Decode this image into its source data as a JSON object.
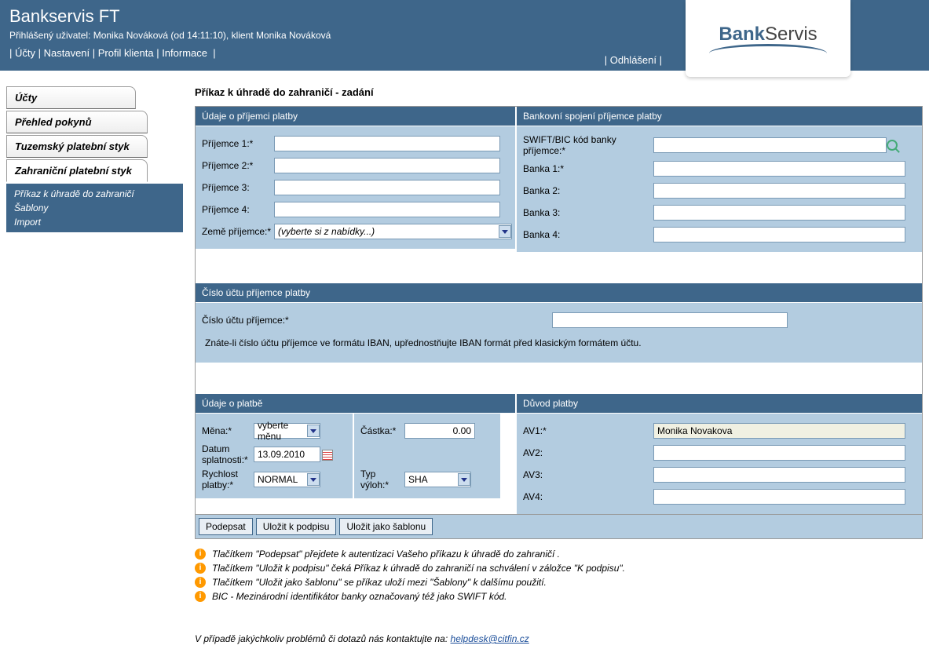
{
  "header": {
    "title": "Bankservis FT",
    "sub": "Přihlášený uživatel: Monika Nováková (od 14:11:10), klient Monika Nováková",
    "nav": [
      "Účty",
      "Nastavení",
      "Profil klienta",
      "Informace"
    ],
    "logout": "Odhlášení",
    "logo_bank": "Bank",
    "logo_servis": "Servis"
  },
  "sidebar": {
    "tabs": [
      "Účty",
      "Přehled pokynů",
      "Tuzemský platební styk",
      "Zahraniční platební styk"
    ],
    "sub": [
      "Příkaz k úhradě do zahraničí",
      "Šablony",
      "Import"
    ]
  },
  "page_title": "Příkaz k úhradě do zahraničí - zadání",
  "sec1": {
    "head": "Údaje o příjemci platby",
    "f1": "Příjemce 1:*",
    "f2": "Příjemce 2:*",
    "f3": "Příjemce 3:",
    "f4": "Příjemce 4:",
    "f5": "Země příjemce:*",
    "f5_placeholder": "(vyberte si z nabídky...)"
  },
  "sec2": {
    "head": "Bankovní spojení příjemce platby",
    "f1": "SWIFT/BIC kód banky příjemce:*",
    "f2": "Banka 1:*",
    "f3": "Banka 2:",
    "f4": "Banka 3:",
    "f5": "Banka 4:"
  },
  "sec3": {
    "head": "Číslo účtu příjemce platby",
    "f1": "Číslo účtu příjemce:*",
    "note": "Znáte-li číslo účtu příjemce ve formátu IBAN, upřednostňujte IBAN formát před klasickým formátem účtu."
  },
  "sec4": {
    "head": "Údaje o platbě",
    "mena": "Měna:*",
    "mena_v": "vyberte měnu",
    "datum": "Datum splatnosti:*",
    "datum_v": "13.09.2010",
    "rychlost": "Rychlost platby:*",
    "rychlost_v": "NORMAL",
    "castka": "Částka:*",
    "castka_v": "0.00",
    "typ": "Typ výloh:*",
    "typ_v": "SHA"
  },
  "sec5": {
    "head": "Důvod platby",
    "av1": "AV1:*",
    "av1_v": "Monika Novakova",
    "av2": "AV2:",
    "av3": "AV3:",
    "av4": "AV4:"
  },
  "buttons": {
    "b1": "Podepsat",
    "b2": "Uložit k podpisu",
    "b3": "Uložit jako šablonu"
  },
  "hints": [
    "Tlačítkem \"Podepsat\" přejdete k autentizaci Vašeho příkazu k úhradě do zahraničí .",
    "Tlačítkem \"Uložit k podpisu\" čeká  Příkaz k úhradě do zahraničí na schválení v záložce \"K podpisu\".",
    "Tlačítkem \"Uložit jako šablonu\" se příkaz uloží mezi \"Šablony\" k dalšímu použití.",
    "BIC - Mezinárodní identifikátor banky označovaný též jako SWIFT kód."
  ],
  "footer": {
    "text": "V případě jakýchkoliv problémů či dotazů nás kontaktujte na: ",
    "email": "helpdesk@citfin.cz"
  }
}
